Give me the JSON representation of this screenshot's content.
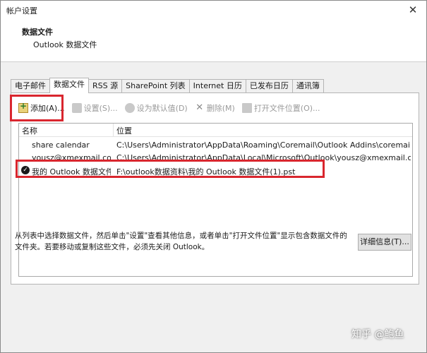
{
  "window": {
    "title": "帐户设置",
    "close_glyph": "✕"
  },
  "header": {
    "title": "数据文件",
    "subtitle": "Outlook 数据文件"
  },
  "tabs": [
    {
      "label": "电子邮件"
    },
    {
      "label": "数据文件"
    },
    {
      "label": "RSS 源"
    },
    {
      "label": "SharePoint 列表"
    },
    {
      "label": "Internet 日历"
    },
    {
      "label": "已发布日历"
    },
    {
      "label": "通讯簿"
    }
  ],
  "toolbar": {
    "add": "添加(A)...",
    "settings": "设置(S)...",
    "set_default": "设为默认值(D)",
    "remove": "删除(M)",
    "open_location": "打开文件位置(O)..."
  },
  "list": {
    "columns": {
      "name": "名称",
      "location": "位置"
    },
    "rows": [
      {
        "name": "share calendar",
        "location": "C:\\Users\\Administrator\\AppData\\Roaming\\Coremail\\Outlook Addins\\coremail....",
        "default": false
      },
      {
        "name": "yousz@xmexmail.com",
        "location": "C:\\Users\\Administrator\\AppData\\Local\\Microsoft\\Outlook\\yousz@xmexmail.co...",
        "default": false
      },
      {
        "name": "我的 Outlook 数据文件...",
        "location": "F:\\outlook数据资料\\我的 Outlook 数据文件(1).pst",
        "default": true
      }
    ]
  },
  "footer": {
    "description": "从列表中选择数据文件，然后单击\"设置\"查看其他信息，或者单击\"打开文件位置\"显示包含数据文件的文件夹。若要移动或复制这些文件，必须先关闭 Outlook。",
    "details_button": "详细信息(T)..."
  },
  "watermark": "知乎 @鲍鱼",
  "colors": {
    "highlight_box": "#d9262e"
  }
}
